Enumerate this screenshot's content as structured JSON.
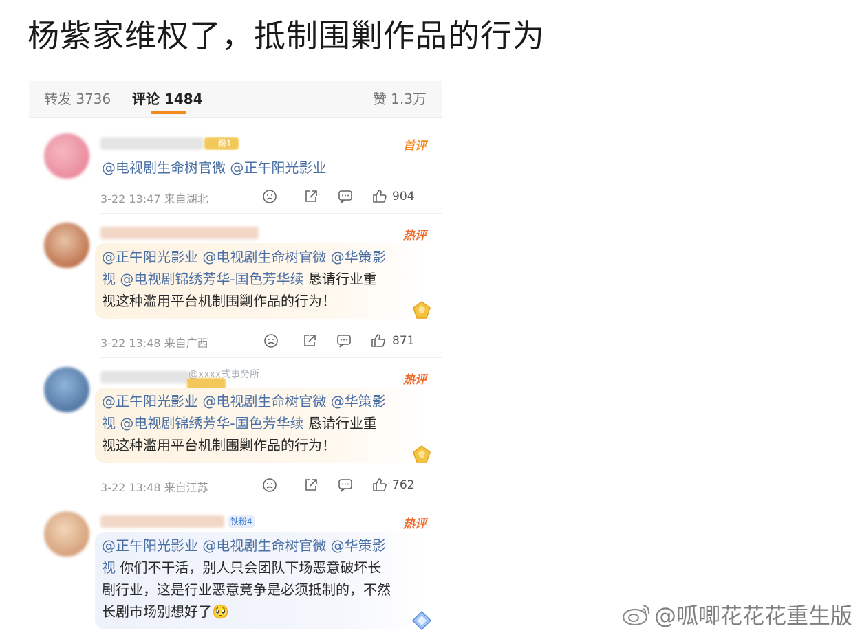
{
  "post": {
    "title": "杨紫家维权了，抵制围剿作品的行为"
  },
  "tabs": {
    "repost": "转发 3736",
    "comments": "评论 1484",
    "likes": "赞 1.3万"
  },
  "comments": [
    {
      "badge_text": "粉1",
      "tag": "首评",
      "text_parts": [
        {
          "text": "@电视剧生命树官微 @正午阳光影业",
          "mention": true
        }
      ],
      "time": "3-22 13:47",
      "location": "来自湖北",
      "likes": "904"
    },
    {
      "tag": "热评",
      "lines": [
        [
          {
            "text": "@正午阳光影业 @电视剧生命树官微 @华策影",
            "mention": true
          }
        ],
        [
          {
            "text": "视 @电视剧锦绣芳华-国色芳华续",
            "mention": true
          },
          {
            "text": " 恳请行业重",
            "mention": false
          }
        ],
        [
          {
            "text": "视这种滥用平台机制围剿作品的行为！",
            "mention": false
          }
        ]
      ],
      "time": "3-22 13:48",
      "location": "来自广西",
      "likes": "871"
    },
    {
      "tag": "热评",
      "overlay_watermark": "@xxxx式事务所",
      "lines": [
        [
          {
            "text": "@正午阳光影业 @电视剧生命树官微 @华策影",
            "mention": true
          }
        ],
        [
          {
            "text": "视 @电视剧锦绣芳华-国色芳华续",
            "mention": true
          },
          {
            "text": " 恳请行业重",
            "mention": false
          }
        ],
        [
          {
            "text": "视这种滥用平台机制围剿作品的行为！",
            "mention": false
          }
        ]
      ],
      "time": "3-22 13:48",
      "location": "来自江苏",
      "likes": "762"
    },
    {
      "badge_text": "铁粉4",
      "tag": "热评",
      "lines": [
        [
          {
            "text": "@正午阳光影业 @电视剧生命树官微 @华策影",
            "mention": true
          }
        ],
        [
          {
            "text": "视",
            "mention": true
          },
          {
            "text": " 你们不干活，别人只会团队下场恶意破坏长",
            "mention": false
          }
        ],
        [
          {
            "text": "剧行业，这是行业恶意竞争是必须抵制的，不然",
            "mention": false
          }
        ],
        [
          {
            "text": "长剧市场别想好了🥺",
            "mention": false
          }
        ]
      ]
    }
  ],
  "watermark": "@呱唧花花花重生版",
  "colors": {
    "accent_orange": "#f28a1e",
    "hot_tag": "#f26a2a",
    "mention_blue": "#4a6fa5"
  },
  "icons": [
    "dislike-icon",
    "share-icon",
    "comment-icon",
    "like-icon",
    "medal-icon",
    "weibo-icon"
  ]
}
